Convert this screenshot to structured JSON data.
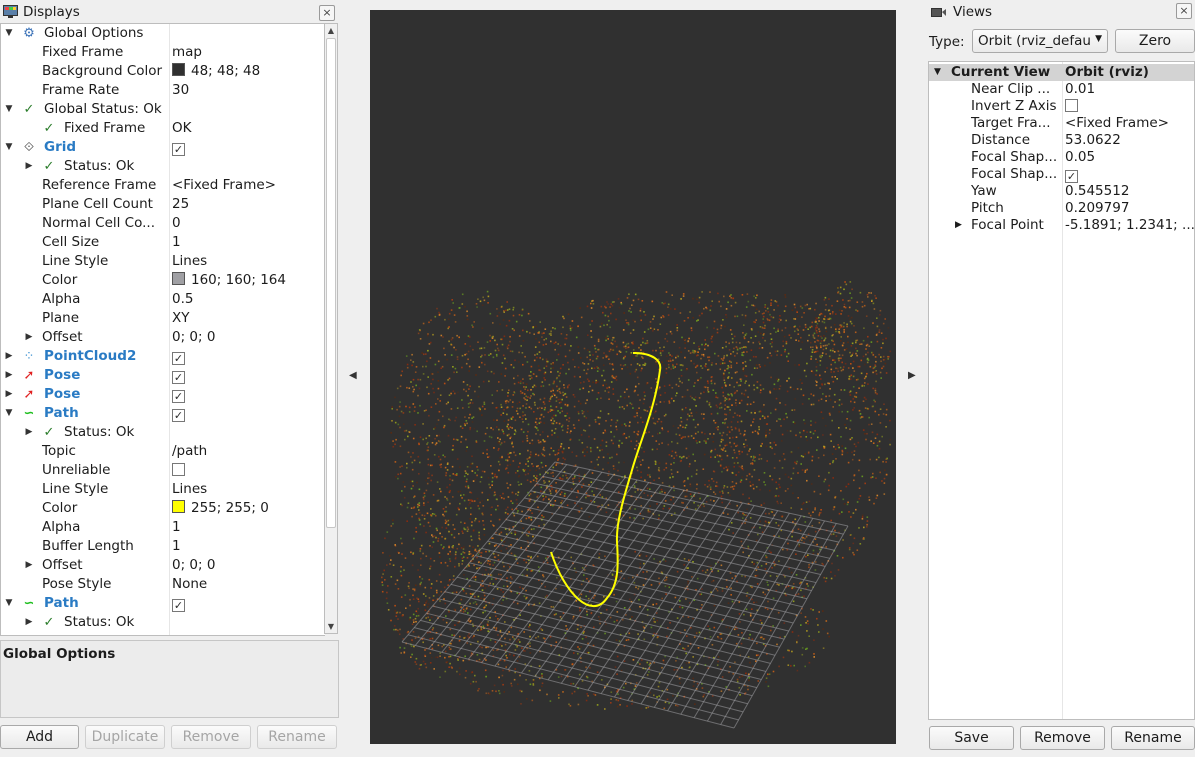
{
  "displays": {
    "title": "Displays",
    "close": "×",
    "rows": [
      {
        "label": "Global Options",
        "value": "",
        "value_type": "text",
        "icon": "gear-icon",
        "glyph": "⚙",
        "expand": "▼",
        "bold": false
      },
      {
        "label": "Fixed Frame",
        "value": "map",
        "value_type": "text"
      },
      {
        "label": "Background Color",
        "value": "48; 48; 48",
        "value_type": "color",
        "swatch": "#303030"
      },
      {
        "label": "Frame Rate",
        "value": "30",
        "value_type": "text"
      },
      {
        "label": "Global Status: Ok",
        "value": "",
        "value_type": "text",
        "icon": "check-icon",
        "glyph": "✓",
        "expand": "▼"
      },
      {
        "label": "Fixed Frame",
        "value": "OK",
        "value_type": "text",
        "icon": "check-icon",
        "glyph": "✓"
      },
      {
        "label": "Grid",
        "value": "",
        "value_type": "checkbox",
        "checked": true,
        "icon": "grid-icon",
        "glyph": "⟐",
        "expand": "▼",
        "bold": true
      },
      {
        "label": "Status: Ok",
        "value": "",
        "value_type": "text",
        "icon": "check-icon",
        "glyph": "✓",
        "expand": "▶"
      },
      {
        "label": "Reference Frame",
        "value": "<Fixed Frame>",
        "value_type": "text"
      },
      {
        "label": "Plane Cell Count",
        "value": "25",
        "value_type": "text"
      },
      {
        "label": "Normal Cell Co...",
        "value": "0",
        "value_type": "text"
      },
      {
        "label": "Cell Size",
        "value": "1",
        "value_type": "text"
      },
      {
        "label": "Line Style",
        "value": "Lines",
        "value_type": "text"
      },
      {
        "label": "Color",
        "value": "160; 160; 164",
        "value_type": "color",
        "swatch": "#a0a0a4"
      },
      {
        "label": "Alpha",
        "value": "0.5",
        "value_type": "text"
      },
      {
        "label": "Plane",
        "value": "XY",
        "value_type": "text"
      },
      {
        "label": "Offset",
        "value": "0; 0; 0",
        "value_type": "text",
        "expand": "▶"
      },
      {
        "label": "PointCloud2",
        "value": "",
        "value_type": "checkbox",
        "checked": true,
        "icon": "pointcloud-icon",
        "glyph": "⁘",
        "expand": "▶",
        "bold": true
      },
      {
        "label": "Pose",
        "value": "",
        "value_type": "checkbox",
        "checked": true,
        "icon": "pose-arrow-icon",
        "glyph": "➚",
        "expand": "▶",
        "bold": true
      },
      {
        "label": "Pose",
        "value": "",
        "value_type": "checkbox",
        "checked": true,
        "icon": "pose-arrow-icon",
        "glyph": "➚",
        "expand": "▶",
        "bold": true
      },
      {
        "label": "Path",
        "value": "",
        "value_type": "checkbox",
        "checked": true,
        "icon": "path-icon",
        "glyph": "∽",
        "expand": "▼",
        "bold": true
      },
      {
        "label": "Status: Ok",
        "value": "",
        "value_type": "text",
        "icon": "check-icon",
        "glyph": "✓",
        "expand": "▶"
      },
      {
        "label": "Topic",
        "value": "/path",
        "value_type": "text"
      },
      {
        "label": "Unreliable",
        "value": "",
        "value_type": "checkbox",
        "checked": false
      },
      {
        "label": "Line Style",
        "value": "Lines",
        "value_type": "text"
      },
      {
        "label": "Color",
        "value": "255; 255; 0",
        "value_type": "color",
        "swatch": "#ffff00"
      },
      {
        "label": "Alpha",
        "value": "1",
        "value_type": "text"
      },
      {
        "label": "Buffer Length",
        "value": "1",
        "value_type": "text"
      },
      {
        "label": "Offset",
        "value": "0; 0; 0",
        "value_type": "text",
        "expand": "▶"
      },
      {
        "label": "Pose Style",
        "value": "None",
        "value_type": "text"
      },
      {
        "label": "Path",
        "value": "",
        "value_type": "checkbox",
        "checked": true,
        "icon": "path-icon",
        "glyph": "∽",
        "expand": "▼",
        "bold": true
      },
      {
        "label": "Status: Ok",
        "value": "",
        "value_type": "text",
        "icon": "check-icon",
        "glyph": "✓",
        "expand": "▶"
      }
    ],
    "description_title": "Global Options",
    "buttons": {
      "add": "Add",
      "duplicate": "Duplicate",
      "remove": "Remove",
      "rename": "Rename"
    }
  },
  "views": {
    "title": "Views",
    "close": "×",
    "type_label": "Type:",
    "type_value": "Orbit (rviz_defau",
    "zero_button": "Zero",
    "header": {
      "name": "Current View",
      "value": "Orbit (rviz)"
    },
    "rows": [
      {
        "label": "Near Clip ...",
        "value": "0.01",
        "value_type": "text"
      },
      {
        "label": "Invert Z Axis",
        "value": "",
        "value_type": "checkbox",
        "checked": false
      },
      {
        "label": "Target Fra...",
        "value": "<Fixed Frame>",
        "value_type": "text"
      },
      {
        "label": "Distance",
        "value": "53.0622",
        "value_type": "text"
      },
      {
        "label": "Focal Shap...",
        "value": "0.05",
        "value_type": "text"
      },
      {
        "label": "Focal Shap...",
        "value": "",
        "value_type": "checkbox",
        "checked": true
      },
      {
        "label": "Yaw",
        "value": "0.545512",
        "value_type": "text"
      },
      {
        "label": "Pitch",
        "value": "0.209797",
        "value_type": "text"
      },
      {
        "label": "Focal Point",
        "value": "-5.1891; 1.2341; ...",
        "value_type": "text",
        "expand": "▶"
      }
    ],
    "buttons": {
      "save": "Save",
      "remove": "Remove",
      "rename": "Rename"
    }
  },
  "colors": {
    "render_background": "#303030",
    "grid_color": "#a0a0a4",
    "path_color": "#ffff00",
    "link_blue": "#2a7bc4",
    "status_green": "#2b7d2b"
  }
}
